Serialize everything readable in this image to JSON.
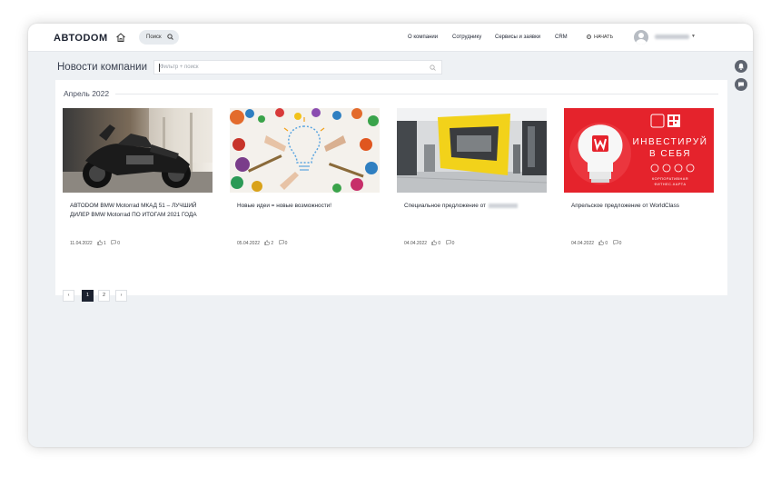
{
  "header": {
    "logo": "АВТОDOM",
    "search_label": "Поиск",
    "nav": [
      {
        "label": "О компании"
      },
      {
        "label": "Сотруднику"
      },
      {
        "label": "Сервисы и заявки"
      },
      {
        "label": "CRM"
      }
    ],
    "start_label": "НАЧАТЬ"
  },
  "page": {
    "title": "Новости компании",
    "filter_placeholder": "Фильтр + поиск"
  },
  "section": {
    "label": "Апрель 2022"
  },
  "cards": [
    {
      "title": "АВТОDOM BMW Motorrad МКАД 51 – ЛУЧШИЙ ДИЛЕР BMW Motorrad ПО ИТОГАМ 2021 ГОДА",
      "date": "11.04.2022",
      "likes": "1",
      "comments": "0"
    },
    {
      "title": "Новые идеи = новые возможности!",
      "date": "05.04.2022",
      "likes": "2",
      "comments": "0"
    },
    {
      "title": "Специальное предложение от",
      "date": "04.04.2022",
      "likes": "0",
      "comments": "0"
    },
    {
      "title": "Апрельское предложение от WorldClass",
      "date": "04.04.2022",
      "likes": "0",
      "comments": "0"
    }
  ],
  "promo": {
    "line1": "ИНВЕСТИРУЙ",
    "line2": "В СЕБЯ",
    "line3": "КОРПОРАТИВНАЯ",
    "line4": "ФИТНЕС-КАРТА"
  },
  "pagination": {
    "prev": "‹",
    "pages": [
      "1",
      "2"
    ],
    "next": "›",
    "current": "1"
  },
  "colors": {
    "accent": "#1c2230",
    "promo_red": "#e5232c",
    "yellow": "#f2d21a"
  }
}
